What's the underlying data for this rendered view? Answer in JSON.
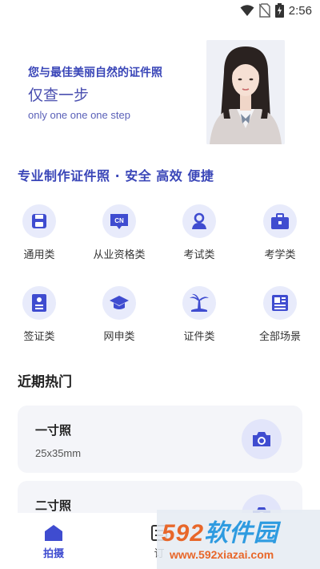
{
  "status_bar": {
    "time": "2:56",
    "icons": [
      "wifi-icon",
      "no-sim-icon",
      "battery-charging-icon"
    ]
  },
  "banner": {
    "title": "您与最佳美丽自然的证件照",
    "subtitle": "仅查一步",
    "english": "only one one one step"
  },
  "section_heading": "专业制作证件照 · 安全 高效 便捷",
  "categories": [
    {
      "label": "通用类",
      "icon": "save-icon"
    },
    {
      "label": "从业资格类",
      "icon": "cn-badge-icon"
    },
    {
      "label": "考试类",
      "icon": "person-icon"
    },
    {
      "label": "考学类",
      "icon": "briefcase-icon"
    },
    {
      "label": "签证类",
      "icon": "document-icon"
    },
    {
      "label": "网申类",
      "icon": "graduation-cap-icon"
    },
    {
      "label": "证件类",
      "icon": "palm-tree-icon"
    },
    {
      "label": "全部场景",
      "icon": "newspaper-icon"
    }
  ],
  "recent_heading": "近期热门",
  "recent_cards": [
    {
      "title": "一寸照",
      "size": "25x35mm",
      "icon": "camera-icon"
    },
    {
      "title": "二寸照",
      "size": "",
      "icon": "camera-icon"
    }
  ],
  "bottom_nav": [
    {
      "label": "拍摄",
      "icon": "home-icon",
      "active": true
    },
    {
      "label": "订",
      "icon": "list-icon",
      "active": false
    }
  ],
  "watermark": {
    "logo_num": "592",
    "logo_cn": "软件园",
    "url": "www.592xiazai.com"
  },
  "colors": {
    "accent": "#3f4cd0",
    "icon_bg": "#e8ebfb",
    "card_bg": "#f4f5f9",
    "watermark_orange": "#e8672a"
  }
}
